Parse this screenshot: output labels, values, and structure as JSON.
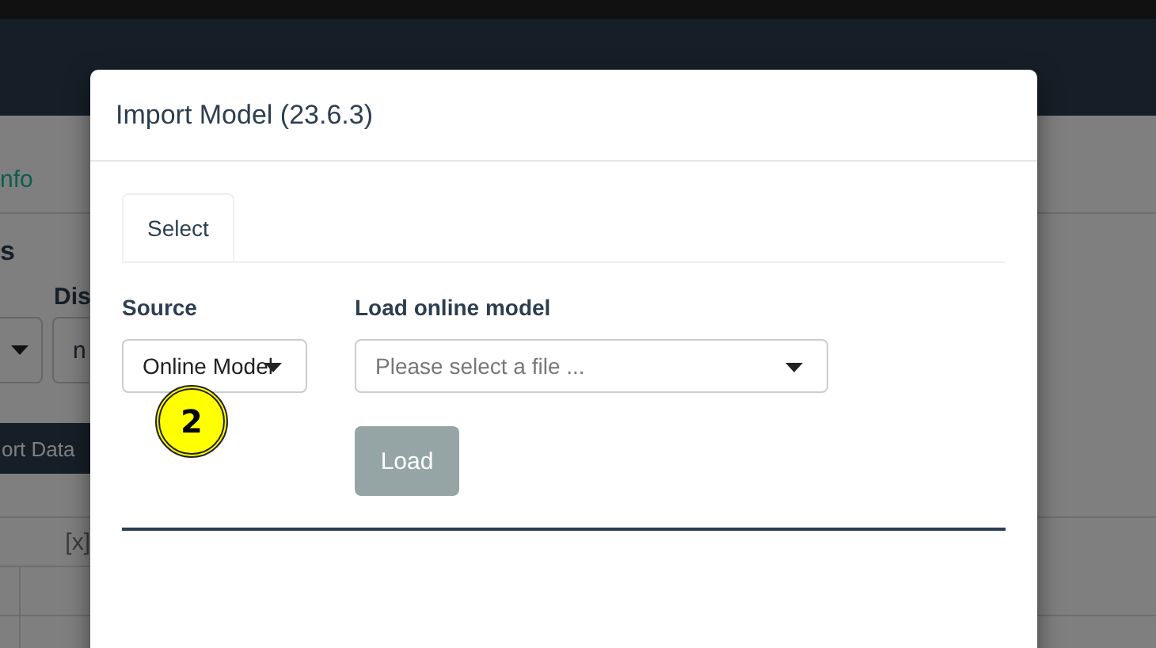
{
  "background": {
    "tabs": [
      {
        "label": "nfo"
      }
    ],
    "section_title": "s",
    "field_label": "Dis",
    "select_value": "n",
    "button": "ort Data",
    "table_header": "[x]"
  },
  "modal": {
    "title": "Import Model (23.6.3)",
    "tabs": [
      {
        "label": "Select",
        "selected": true
      }
    ],
    "source": {
      "label": "Source",
      "value": "Online Model"
    },
    "online_model": {
      "label": "Load online model",
      "placeholder": "Please select a file ..."
    },
    "load_button": {
      "label": "Load",
      "disabled": true
    }
  },
  "annotation": {
    "number": "2"
  }
}
